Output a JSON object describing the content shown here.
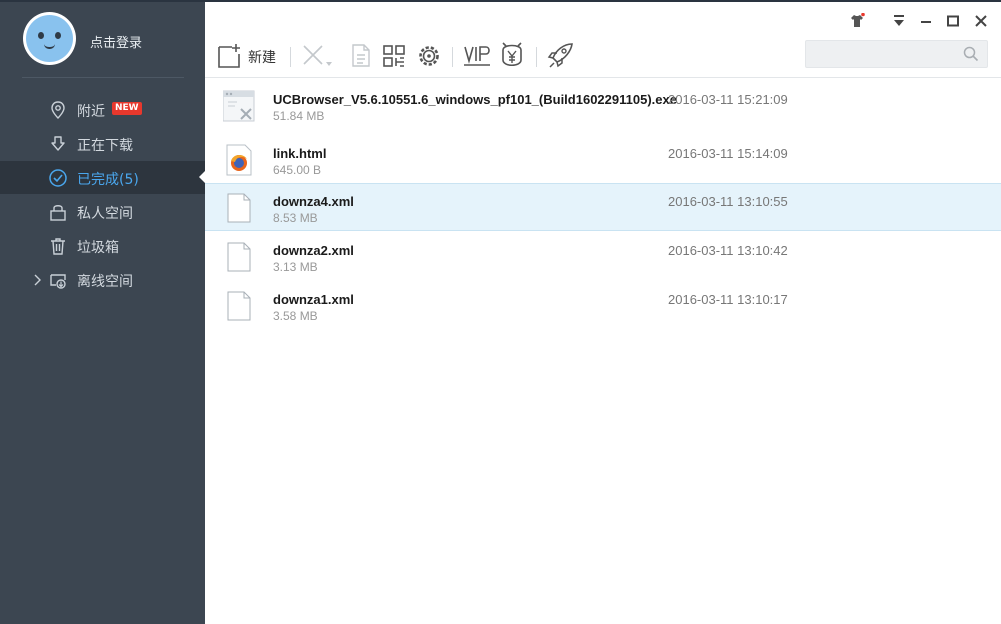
{
  "profile": {
    "login_text": "点击登录"
  },
  "nav": {
    "items": [
      {
        "label": "附近",
        "icon": "location-pin-icon",
        "badge": "NEW"
      },
      {
        "label": "正在下载",
        "icon": "download-arrow-icon"
      },
      {
        "label": "已完成(5)",
        "icon": "check-circle-icon",
        "active": true
      },
      {
        "label": "私人空间",
        "icon": "lock-icon"
      },
      {
        "label": "垃圾箱",
        "icon": "trash-icon"
      },
      {
        "label": "离线空间",
        "icon": "cloud-download-icon"
      }
    ]
  },
  "toolbar": {
    "new_label": "新建",
    "search": {
      "placeholder": ""
    },
    "icons": [
      "new-file-icon",
      "delete-icon",
      "details-icon",
      "qr-code-icon",
      "settings-cog-icon",
      "vip-icon",
      "yen-icon",
      "rocket-icon"
    ],
    "window_icons": [
      "skin-icon",
      "menu-dropdown-icon",
      "minimize-icon",
      "maximize-icon",
      "close-icon"
    ]
  },
  "files": [
    {
      "name": "UCBrowser_V5.6.10551.6_windows_pf101_(Build1602291105).exe",
      "size": "51.84 MB",
      "date": "2016-03-11 15:21:09",
      "icon": "exe-file-icon"
    },
    {
      "name": "link.html",
      "size": "645.00 B",
      "date": "2016-03-11 15:14:09",
      "icon": "firefox-html-icon"
    },
    {
      "name": "downza4.xml",
      "size": "8.53 MB",
      "date": "2016-03-11 13:10:55",
      "icon": "document-file-icon",
      "selected": true
    },
    {
      "name": "downza2.xml",
      "size": "3.13 MB",
      "date": "2016-03-11 13:10:42",
      "icon": "document-file-icon"
    },
    {
      "name": "downza1.xml",
      "size": "3.58 MB",
      "date": "2016-03-11 13:10:17",
      "icon": "document-file-icon"
    }
  ],
  "colors": {
    "sidebar_bg": "#3c4651",
    "active_item_bg": "#2d353e",
    "accent": "#4aa7ee",
    "selected_row_bg": "#e5f3fb",
    "badge_red": "#e8382d"
  }
}
